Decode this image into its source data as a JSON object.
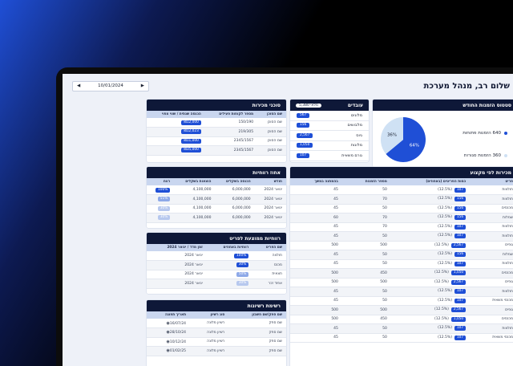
{
  "header": {
    "greeting": "שלום רב, מנהל מערכת",
    "date": "10/01/2024",
    "prev": "◀",
    "next": "▶"
  },
  "orders_status": {
    "title": "סטטוס הזמנות החודש",
    "legend": [
      {
        "label": "640 הזמנות פתוחות"
      },
      {
        "label": "360 הזמנות סגורות"
      }
    ],
    "chart_data": {
      "type": "pie",
      "categories": [
        "הזמנות פתוחות",
        "הזמנות סגורות"
      ],
      "values": [
        640,
        360
      ],
      "labels": [
        "64%",
        "36%"
      ],
      "colors": [
        "#1f4fd6",
        "#cfe1f4"
      ]
    }
  },
  "employees": {
    "title": "עובדים",
    "badge": "מלאי 5,380",
    "rows": [
      {
        "name": "מלונים",
        "value": "567"
      },
      {
        "name": "מלבושים",
        "value": "156"
      },
      {
        "name": "גיוס",
        "value": "2,567"
      },
      {
        "name": "מלונות",
        "value": "1,050"
      },
      {
        "name": "גורם משאית",
        "value": "107"
      }
    ]
  },
  "stock": {
    "title": "סוכני מכירות",
    "headers": [
      "שם הסוכן",
      "מספר לקוחות פעילים",
      "הכנסה שנתית / שווי צפוי"
    ],
    "rows": [
      [
        "שם הסוכן",
        "150/190",
        "₪12,000"
      ],
      [
        "שם הסוכן",
        "219/305",
        "₪12,023"
      ],
      [
        "שם הסוכן",
        "2345/1567",
        "₪11,000"
      ],
      [
        "שם הסוכן",
        "2345/1567",
        "₪35,000"
      ]
    ]
  },
  "trends": {
    "title": "אחוז רווחיות",
    "headers": [
      "חודש",
      "הכנסה בשקלים",
      "הוצאות בשקלים",
      "רווח"
    ],
    "rows": [
      [
        "ינואר 2024",
        "6,000,000",
        "4,100,000",
        "100%",
        ""
      ],
      [
        "ינואר 2024",
        "6,000,000",
        "4,100,000",
        "51%",
        "pale"
      ],
      [
        "ינואר 2024",
        "6,000,000",
        "4,100,000",
        "30%",
        "light"
      ],
      [
        "ינואר 2024",
        "6,000,000",
        "4,100,000",
        "30%",
        "light"
      ]
    ]
  },
  "profit": {
    "title": "רווחיות ממוצעת לפריט",
    "headers": [
      "שם הפריט",
      "רווחיות באחוזים",
      "זמן מדד / ינואר 2024"
    ],
    "rows": [
      [
        "חולצה",
        "100%",
        "ינואר 2024",
        ""
      ],
      [
        "מכנס",
        "30%",
        "ינואר 2024",
        ""
      ],
      [
        "חצאית",
        "50%",
        "ינואר 2024",
        "pale"
      ],
      [
        "אפוד זכר",
        "30%",
        "ינואר 2024",
        "light"
      ]
    ]
  },
  "licenses": {
    "title": "רשימת רשיונות",
    "headers": [
      "שם ספק/שם חשבון",
      "סוג רשיון",
      "תאריך תפוגה"
    ],
    "rows": [
      [
        "שם ספק",
        "רשיון מלונה",
        "16/07/24"
      ],
      [
        "שם ספק",
        "רשיון מלונה",
        "28/10/24"
      ],
      [
        "שם ספק",
        "רשיון מלונה",
        "10/12/24"
      ],
      [
        "שם ספק",
        "רשיון מלונה",
        "01/02/25"
      ]
    ]
  },
  "sales": {
    "title": "מכירות לפי מקצוע",
    "headers": [
      "פריט",
      "כמות הפריטים (באחוזים)",
      "מספר הזמנות",
      "בהמתנה במשך"
    ],
    "rows": [
      [
        "חולצות",
        "107",
        "(12.5%)",
        "50",
        "45"
      ],
      [
        "חולצות",
        "156",
        "(12.5%)",
        "70",
        "45"
      ],
      [
        "מכנסים",
        "156",
        "(12.5%)",
        "50",
        "45"
      ],
      [
        "שמלות",
        "156",
        "(12.5%)",
        "70",
        "60"
      ],
      [
        "חולצות",
        "107",
        "(12.5%)",
        "70",
        "45"
      ],
      [
        "חולצות",
        "107",
        "(12.5%)",
        "50",
        "45"
      ],
      [
        "גופים",
        "2,567",
        "(12.5%)",
        "500",
        "500"
      ],
      [
        "שמלות",
        "156",
        "(12.5%)",
        "50",
        "45"
      ],
      [
        "חולצות",
        "107",
        "(12.5%)",
        "50",
        "45"
      ],
      [
        "מכנסים",
        "1,050",
        "(12.5%)",
        "450",
        "500"
      ],
      [
        "גופים",
        "2,567",
        "(12.5%)",
        "500",
        "500"
      ],
      [
        "חולצות",
        "107",
        "(12.5%)",
        "50",
        "45"
      ],
      [
        "מכנסי משאית",
        "107",
        "(12.5%)",
        "50",
        "45"
      ],
      [
        "גופים",
        "2,567",
        "(12.5%)",
        "500",
        "500"
      ],
      [
        "מכנסים",
        "1,050",
        "(12.5%)",
        "450",
        "500"
      ],
      [
        "חולצות",
        "107",
        "(12.5%)",
        "50",
        "45"
      ],
      [
        "מכנסי משאית",
        "107",
        "(12.5%)",
        "50",
        "45"
      ]
    ]
  }
}
